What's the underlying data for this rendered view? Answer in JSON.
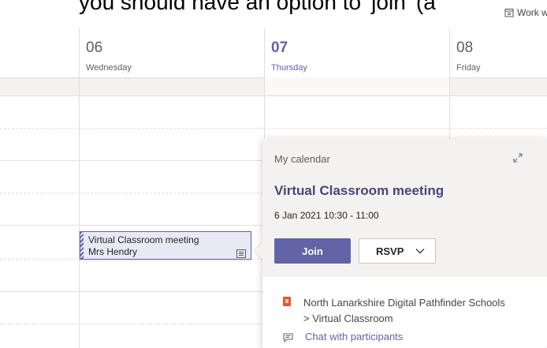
{
  "caption": "you should have an option to 'join' (a",
  "view_switch": {
    "label": "Work week",
    "icon": "calendar-icon"
  },
  "days": [
    {
      "num": "06",
      "name": "Wednesday",
      "today": false
    },
    {
      "num": "07",
      "name": "Thursday",
      "today": true
    },
    {
      "num": "08",
      "name": "Friday",
      "today": false
    }
  ],
  "event": {
    "title": "Virtual Classroom meeting",
    "organizer": "Mrs Hendry",
    "icon": "meeting-details-icon"
  },
  "popup": {
    "calendar_name": "My calendar",
    "expand_icon": "expand-icon",
    "title": "Virtual Classroom meeting",
    "time": "6 Jan 2021 10:30 - 11:00",
    "join_label": "Join",
    "rsvp_label": "RSVP",
    "channel_line1": "North Lanarkshire Digital Pathfinder Schools",
    "channel_line2": "> Virtual Classroom",
    "chat_label": "Chat with participants"
  },
  "colors": {
    "accent": "#6264a7",
    "event_bg": "#e8e9f4",
    "channel_icon": "#e8533c"
  }
}
